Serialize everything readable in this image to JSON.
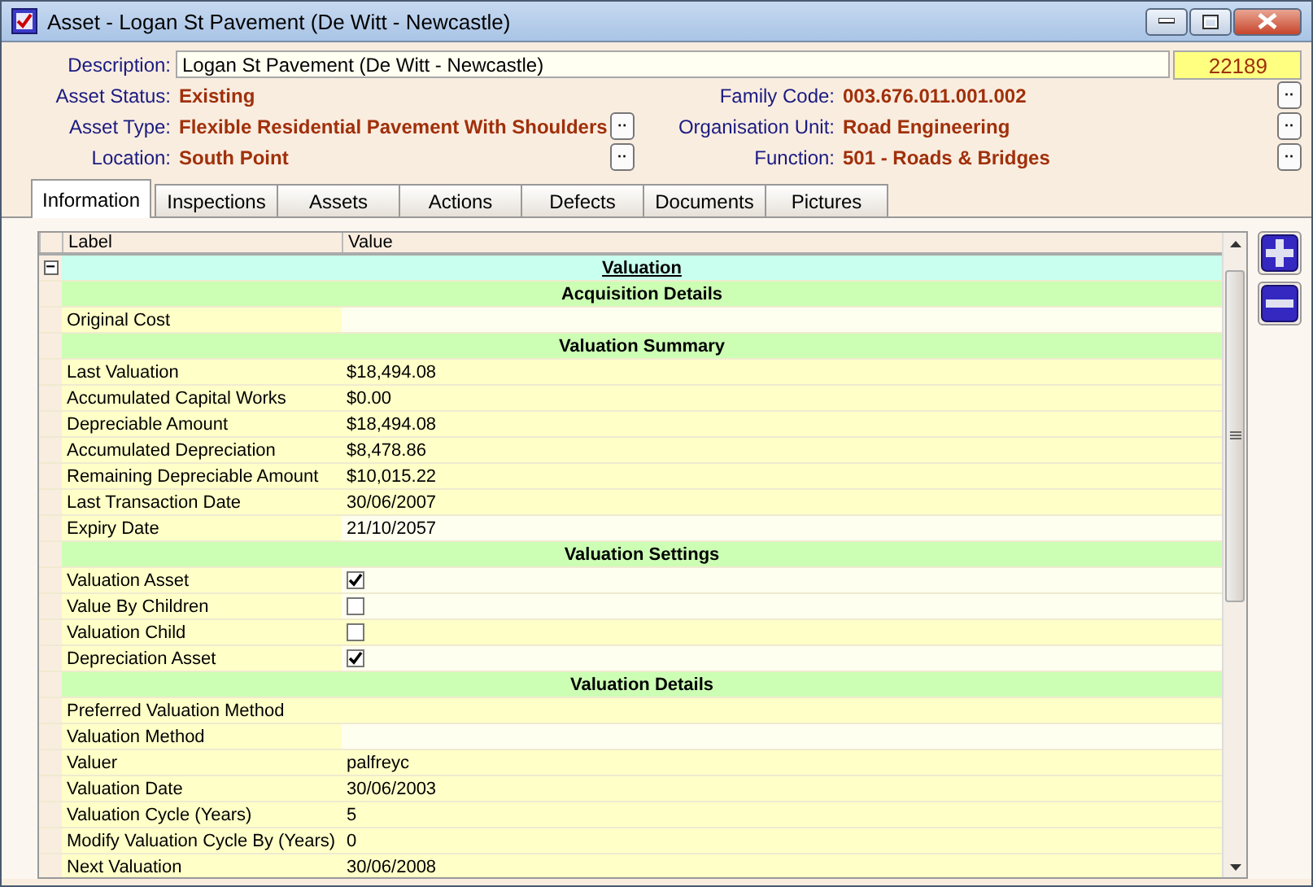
{
  "window": {
    "title": "Asset - Logan St Pavement (De Witt - Newcastle)"
  },
  "header": {
    "id": "22189",
    "fields": [
      {
        "label": "Description:",
        "value": "Logan St Pavement (De Witt - Newcastle)",
        "kind": "text"
      },
      {
        "label": "Asset Status:",
        "value": "Existing",
        "kind": "plain"
      },
      {
        "label": "Family Code:",
        "value": "003.676.011.001.002",
        "kind": "lookup"
      },
      {
        "label": "Asset Type:",
        "value": "Flexible Residential Pavement With Shoulders",
        "kind": "lookup"
      },
      {
        "label": "Organisation Unit:",
        "value": "Road Engineering",
        "kind": "lookup"
      },
      {
        "label": "Location:",
        "value": "South Point",
        "kind": "lookup"
      },
      {
        "label": "Function:",
        "value": "501 - Roads & Bridges",
        "kind": "lookup"
      }
    ],
    "lookup_button": "··"
  },
  "tabs": [
    {
      "label": "Information",
      "selected": true
    },
    {
      "label": "Inspections",
      "selected": false
    },
    {
      "label": "Assets",
      "selected": false
    },
    {
      "label": "Actions",
      "selected": false
    },
    {
      "label": "Defects",
      "selected": false
    },
    {
      "label": "Documents",
      "selected": false
    },
    {
      "label": "Pictures",
      "selected": false
    }
  ],
  "grid": {
    "columns": [
      "Label",
      "Value"
    ],
    "collapse_toggle": "−",
    "rows": [
      {
        "kind": "group",
        "label": "Valuation"
      },
      {
        "kind": "section",
        "label": "Acquisition Details"
      },
      {
        "kind": "text",
        "label": "Original Cost",
        "editable": true
      },
      {
        "kind": "section",
        "label": "Valuation Summary"
      },
      {
        "kind": "text",
        "label": "Last Valuation",
        "value": "$18,494.08",
        "editable": false
      },
      {
        "kind": "text",
        "label": "Accumulated Capital Works",
        "value": "$0.00",
        "editable": false
      },
      {
        "kind": "text",
        "label": "Depreciable Amount",
        "value": "$18,494.08",
        "editable": false
      },
      {
        "kind": "text",
        "label": "Accumulated Depreciation",
        "value": "$8,478.86",
        "editable": false
      },
      {
        "kind": "text",
        "label": "Remaining Depreciable Amount",
        "value": "$10,015.22",
        "editable": false
      },
      {
        "kind": "text",
        "label": "Last Transaction Date",
        "value": "30/06/2007",
        "editable": false
      },
      {
        "kind": "text",
        "label": "Expiry Date",
        "value": "21/10/2057",
        "editable": true
      },
      {
        "kind": "section",
        "label": "Valuation Settings"
      },
      {
        "kind": "check",
        "label": "Valuation Asset",
        "checked": true,
        "editable": true
      },
      {
        "kind": "check",
        "label": "Value By Children",
        "checked": false,
        "editable": true
      },
      {
        "kind": "check",
        "label": "Valuation Child",
        "checked": false,
        "editable": false
      },
      {
        "kind": "check",
        "label": "Depreciation Asset",
        "checked": true,
        "editable": true
      },
      {
        "kind": "section",
        "label": "Valuation Details"
      },
      {
        "kind": "text",
        "label": "Preferred Valuation Method",
        "editable": false
      },
      {
        "kind": "text",
        "label": "Valuation Method",
        "editable": true
      },
      {
        "kind": "text",
        "label": "Valuer",
        "value": "palfreyc",
        "editable": false
      },
      {
        "kind": "text",
        "label": "Valuation Date",
        "value": "30/06/2003",
        "editable": false
      },
      {
        "kind": "text",
        "label": "Valuation Cycle (Years)",
        "value": "5",
        "editable": false
      },
      {
        "kind": "text",
        "label": "Modify Valuation Cycle By (Years)",
        "value": "0",
        "editable": false
      },
      {
        "kind": "text",
        "label": "Next Valuation",
        "value": "30/06/2008",
        "editable": false
      }
    ]
  }
}
